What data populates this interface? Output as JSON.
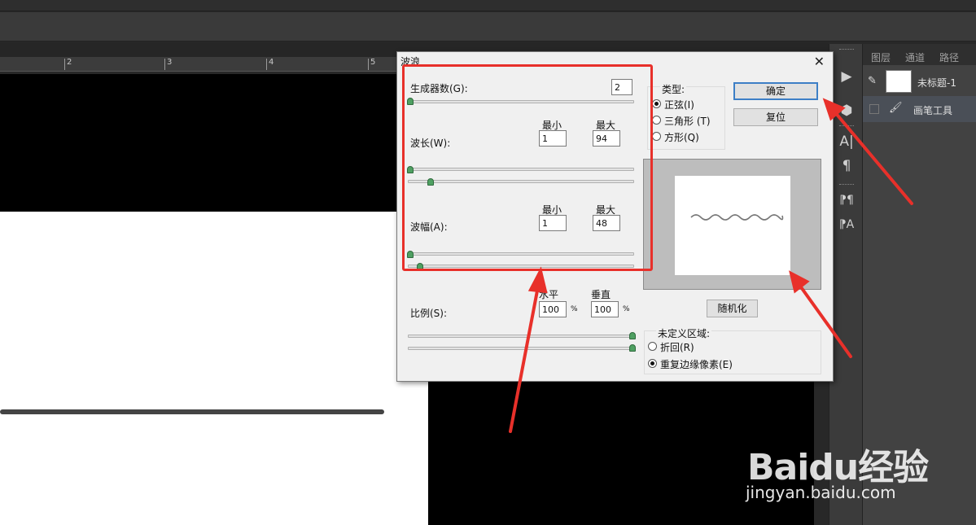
{
  "ruler": {
    "marks": [
      "2",
      "3",
      "4",
      "5"
    ]
  },
  "dialog": {
    "title": "波浪",
    "close_symbol": "✕",
    "generators_label": "生成器数(G):",
    "generators_value": "2",
    "wavelength_label": "波长(W):",
    "wavelength": {
      "min_label": "最小",
      "max_label": "最大",
      "min": "1",
      "max": "94"
    },
    "amplitude_label": "波幅(A):",
    "amplitude": {
      "min_label": "最小",
      "max_label": "最大",
      "min": "1",
      "max": "48"
    },
    "scale_label": "比例(S):",
    "scale": {
      "h_label": "水平",
      "v_label": "垂直",
      "h": "100",
      "v": "100",
      "unit": "%"
    },
    "type_label": "类型:",
    "types": [
      "正弦(I)",
      "三角形 (T)",
      "方形(Q)"
    ],
    "type_selected": "正弦(I)",
    "ok_label": "确定",
    "reset_label": "复位",
    "randomize_label": "随机化",
    "undefined_label": "未定义区域:",
    "undefined_options": [
      "折回(R)",
      "重复边缘像素(E)"
    ],
    "undefined_selected": "重复边缘像素(E)"
  },
  "layers_panel": {
    "tabs": [
      "图层",
      "通道",
      "路径"
    ],
    "layer_name": "未标题-1",
    "tool_name": "画笔工具"
  },
  "watermark": {
    "logo": "Baidu经验",
    "url": "jingyan.baidu.com"
  },
  "colors": {
    "annotation_red": "#e8302a",
    "slider_green": "#4fa062",
    "default_button_blue": "#3d7fc6"
  }
}
